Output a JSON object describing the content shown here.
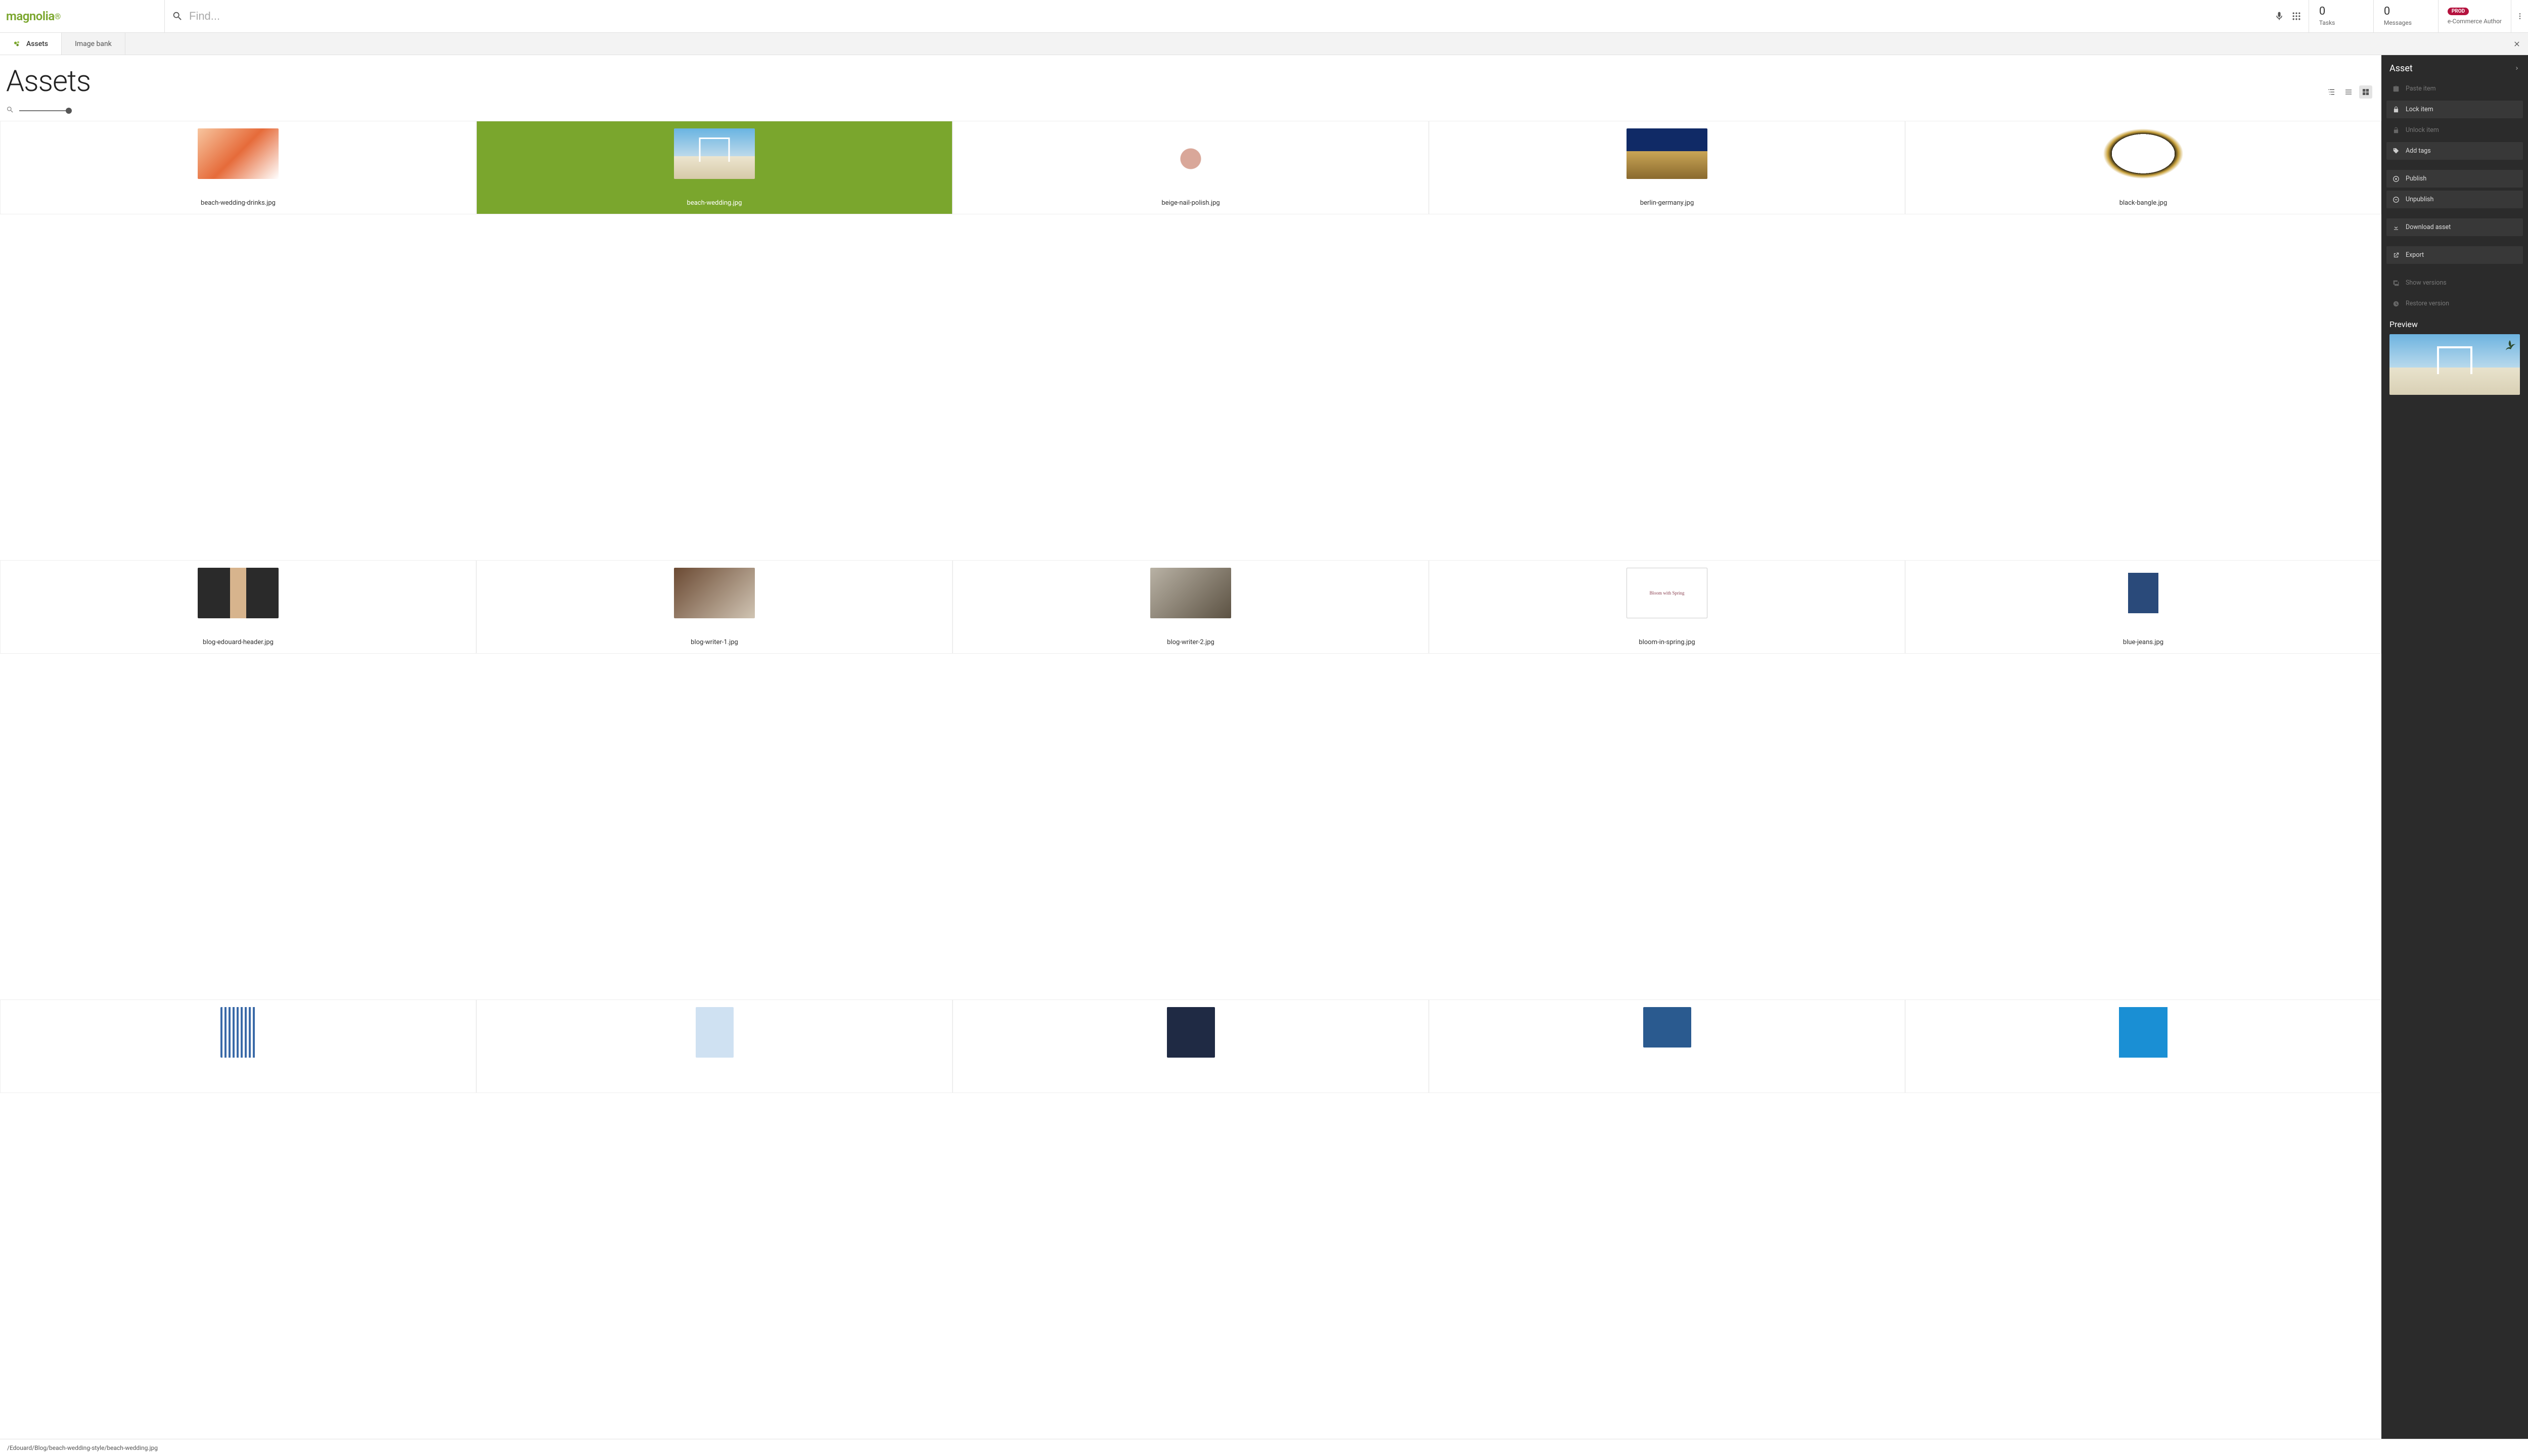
{
  "brand": "magnolia",
  "search": {
    "placeholder": "Find..."
  },
  "stats": {
    "tasks_count": "0",
    "tasks_label": "Tasks",
    "messages_count": "0",
    "messages_label": "Messages"
  },
  "user": {
    "env_badge": "PROD",
    "role": "e-Commerce Author"
  },
  "tabs": [
    {
      "label": "Assets",
      "active": true
    },
    {
      "label": "Image bank",
      "active": false
    }
  ],
  "page": {
    "title": "Assets"
  },
  "assets": [
    {
      "filename": "beach-wedding-drinks.jpg",
      "selected": false,
      "thumb": "ph-drinks"
    },
    {
      "filename": "beach-wedding.jpg",
      "selected": true,
      "thumb": "ph-wedding"
    },
    {
      "filename": "beige-nail-polish.jpg",
      "selected": false,
      "thumb": "ph-polish"
    },
    {
      "filename": "berlin-germany.jpg",
      "selected": false,
      "thumb": "ph-berlin"
    },
    {
      "filename": "black-bangle.jpg",
      "selected": false,
      "thumb": "ph-bangle"
    },
    {
      "filename": "blog-edouard-header.jpg",
      "selected": false,
      "thumb": "ph-edouard"
    },
    {
      "filename": "blog-writer-1.jpg",
      "selected": false,
      "thumb": "ph-writer1"
    },
    {
      "filename": "blog-writer-2.jpg",
      "selected": false,
      "thumb": "ph-writer2"
    },
    {
      "filename": "bloom-in-spring.jpg",
      "selected": false,
      "thumb": "ph-bloom"
    },
    {
      "filename": "blue-jeans.jpg",
      "selected": false,
      "thumb": "ph-jeans"
    },
    {
      "filename": "",
      "selected": false,
      "thumb": "ph-stripes"
    },
    {
      "filename": "",
      "selected": false,
      "thumb": "ph-shirt2"
    },
    {
      "filename": "",
      "selected": false,
      "thumb": "ph-sweater"
    },
    {
      "filename": "",
      "selected": false,
      "thumb": "ph-shorts"
    },
    {
      "filename": "",
      "selected": false,
      "thumb": "ph-sandals"
    }
  ],
  "panel": {
    "title": "Asset",
    "actions": [
      {
        "label": "Paste item",
        "icon": "paste",
        "enabled": false
      },
      {
        "label": "Lock item",
        "icon": "lock",
        "enabled": true
      },
      {
        "label": "Unlock item",
        "icon": "unlock",
        "enabled": false
      },
      {
        "label": "Add tags",
        "icon": "tag",
        "enabled": true
      },
      {
        "gap": true
      },
      {
        "label": "Publish",
        "icon": "publish",
        "enabled": true
      },
      {
        "label": "Unpublish",
        "icon": "unpublish",
        "enabled": true
      },
      {
        "gap": true
      },
      {
        "label": "Download asset",
        "icon": "download",
        "enabled": true
      },
      {
        "gap": true
      },
      {
        "label": "Export",
        "icon": "export",
        "enabled": true
      },
      {
        "gap": true
      },
      {
        "label": "Show versions",
        "icon": "versions",
        "enabled": false
      },
      {
        "label": "Restore version",
        "icon": "restore",
        "enabled": false
      }
    ],
    "preview_title": "Preview"
  },
  "statusbar": {
    "path": "/Edouard/Blog/beach-wedding-style/beach-wedding.jpg"
  }
}
